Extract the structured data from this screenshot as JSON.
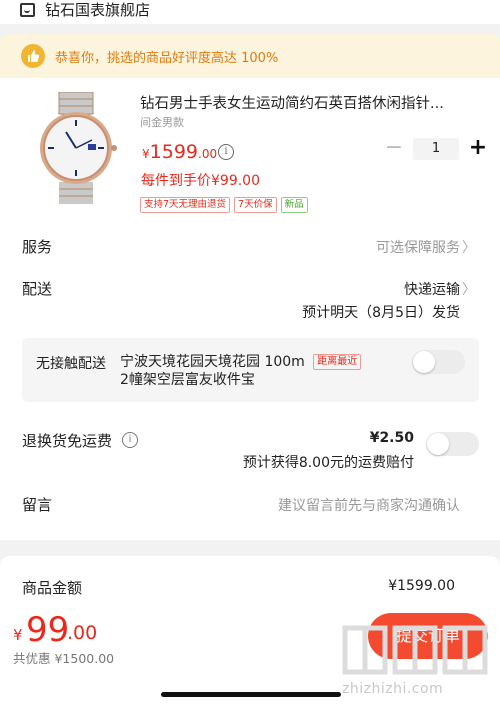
{
  "store": {
    "name": "钻石国表旗舰店",
    "icon": "store-icon"
  },
  "banner": {
    "text": "恭喜你，挑选的商品好评度高达 100%",
    "icon": "thumb-up-icon",
    "background": "#fdf4dd",
    "color": "#e07b12"
  },
  "product": {
    "title": "钻石男士手表女生运动简约石英百搭休闲指针...",
    "spec": "间金男款",
    "price_currency": "¥",
    "price_int": "1599",
    "price_dec": ".00",
    "per_unit_price": "每件到手价¥99.00",
    "tags": [
      "支持7天无理由退货",
      "7天价保",
      "新品"
    ],
    "quantity": "1",
    "minus": "−",
    "plus": "+"
  },
  "rows": {
    "service": {
      "label": "服务",
      "value": "可选保障服务"
    },
    "delivery": {
      "label": "配送",
      "method": "快递运输",
      "eta": "预计明天（8月5日）发货"
    },
    "contactless": {
      "label": "无接触配送",
      "address": "宁波天境花园天境花园 100m",
      "address_line2": "2幢架空层富友收件宝",
      "badge": "距离最近"
    },
    "return_shipping": {
      "label": "退换货免运费",
      "price": "¥2.50",
      "note": "预计获得8.00元的运费赔付"
    },
    "message": {
      "label": "留言",
      "placeholder": "建议留言前先与商家沟通确认"
    }
  },
  "summary": {
    "label": "商品金额",
    "value": "¥1599.00"
  },
  "bottom": {
    "currency": "¥",
    "total_int": "99",
    "total_dec": ".00",
    "discount": "共优惠 ¥1500.00",
    "submit": "提交订单",
    "watermark_domain": "zhizhizhi.com"
  },
  "colors": {
    "accent": "#e8291c",
    "button": "#f44a2f"
  }
}
